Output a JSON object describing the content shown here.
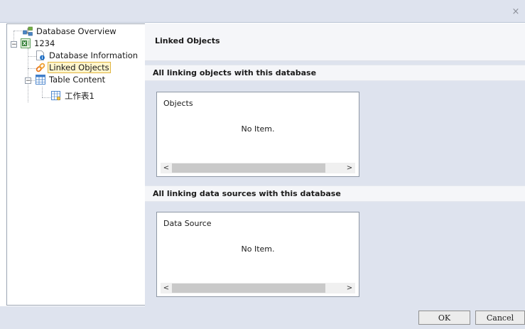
{
  "window": {
    "close_glyph": "×"
  },
  "tree": {
    "root": {
      "label": "Database Overview",
      "icon": "database-overview-icon"
    },
    "db": {
      "label": "1234",
      "icon": "excel-file-icon",
      "expander": "−"
    },
    "info": {
      "label": "Database Information",
      "icon": "database-info-icon"
    },
    "linked": {
      "label": "Linked Objects",
      "icon": "link-icon"
    },
    "table": {
      "label": "Table Content",
      "icon": "table-icon",
      "expander": "−"
    },
    "sheet": {
      "label": "工作表1",
      "icon": "sheet-icon"
    }
  },
  "content": {
    "title": "Linked Objects",
    "objects_section": {
      "heading": "All linking objects with this database",
      "box_title": "Objects",
      "empty_text": "No Item."
    },
    "datasource_section": {
      "heading": "All linking data sources with this database",
      "box_title": "Data Source",
      "empty_text": "No Item."
    },
    "scroll_left": "<",
    "scroll_right": ">"
  },
  "footer": {
    "ok_label": "OK",
    "cancel_label": "Cancel"
  },
  "colors": {
    "chrome": "#dee3ee",
    "selection_fill": "#fff5cc",
    "selection_border": "#e0b541"
  }
}
